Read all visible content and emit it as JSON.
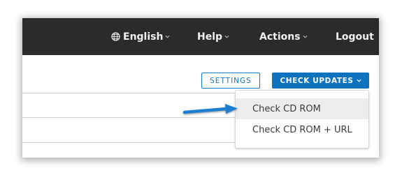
{
  "topbar": {
    "language_label": "English",
    "help_label": "Help",
    "actions_label": "Actions",
    "logout_label": "Logout"
  },
  "toolbar": {
    "settings_label": "SETTINGS",
    "check_updates_label": "CHECK UPDATES"
  },
  "dropdown": {
    "items": [
      {
        "label": "Check CD ROM"
      },
      {
        "label": "Check CD ROM + URL"
      }
    ]
  },
  "colors": {
    "topbar_bg": "#2b2b2b",
    "primary": "#0f72bf",
    "annotation_arrow": "#1a7fcf"
  },
  "icons": {
    "language": "globe-icon",
    "dropdown": "chevron-down-icon",
    "annotation": "arrow-right-icon"
  }
}
